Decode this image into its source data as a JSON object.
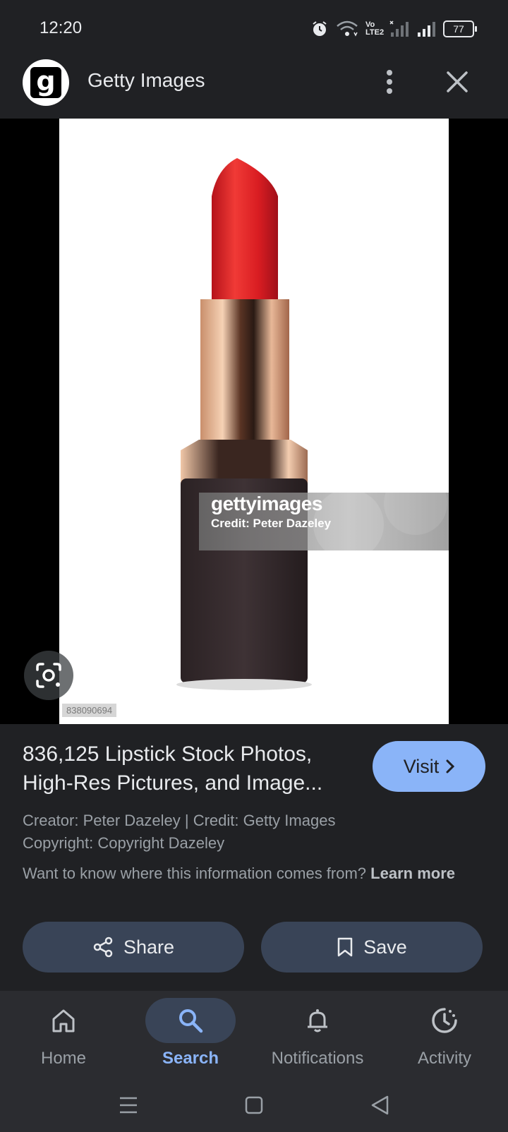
{
  "status_bar": {
    "time": "12:20",
    "battery": "77",
    "volte_label": "Vo LTE2"
  },
  "header": {
    "logo_letter": "g",
    "title": "Getty Images"
  },
  "image": {
    "watermark_brand": "gettyimages",
    "watermark_credit": "Credit: Peter Dazeley",
    "image_id": "838090694"
  },
  "info": {
    "title": "836,125 Lipstick Stock Photos, High-Res Pictures, and Image...",
    "visit_label": "Visit",
    "creator_line": "Creator: Peter Dazeley | Credit: Getty Images",
    "copyright_line": "Copyright: Copyright Dazeley",
    "learn_prefix": "Want to know where this information comes from?",
    "learn_link": "Learn more",
    "share_label": "Share",
    "save_label": "Save"
  },
  "bottom_nav": {
    "items": [
      {
        "label": "Home",
        "icon": "home-icon"
      },
      {
        "label": "Search",
        "icon": "search-icon",
        "active": true
      },
      {
        "label": "Notifications",
        "icon": "bell-icon"
      },
      {
        "label": "Activity",
        "icon": "activity-icon"
      }
    ]
  },
  "colors": {
    "background": "#202124",
    "accent": "#8ab4f8",
    "button_bg": "#394457",
    "lipstick_red": "#e01e22"
  }
}
